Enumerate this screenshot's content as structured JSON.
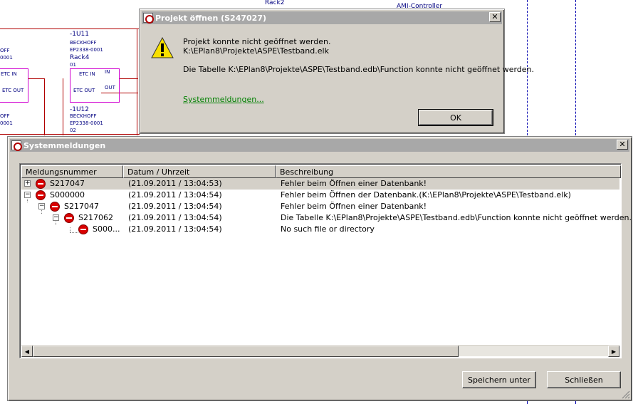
{
  "schematic": {
    "labels": {
      "rack2": "Rack2",
      "ami": "AMI-Controller",
      "u11_tag": "-1U11",
      "u11_maker": "BECKHOFF",
      "u11_part": "EP2338-0001",
      "u11_rack": "Rack4",
      "u11_pos": "01",
      "u12_tag": "-1U12",
      "u12_maker": "BECKHOFF",
      "u12_part": "EP2338-0001",
      "u12_pos": "02",
      "etc_in": "ETC IN",
      "in": "IN",
      "etc_out": "ETC OUT",
      "out": "OUT",
      "left_off": "OFF",
      "left_0001": "0001",
      "left_etc_in": "ETC IN",
      "left_etc_out": "ETC OUT",
      "left_e": "E"
    }
  },
  "dialog_open": {
    "title": "Projekt öffnen (S247027)",
    "line1": "Projekt konnte nicht geöffnet werden.",
    "line2": "K:\\EPlan8\\Projekte\\ASPE\\Testband.elk",
    "line3": "Die Tabelle K:\\EPlan8\\Projekte\\ASPE\\Testband.edb\\Function konnte nicht geöffnet werden.",
    "link": "Systemmeldungen...",
    "ok": "OK",
    "close": "✕"
  },
  "dialog_sys": {
    "title": "Systemmeldungen",
    "close": "✕",
    "columns": [
      "Meldungsnummer",
      "Datum / Uhrzeit",
      "Beschreibung"
    ],
    "rows": [
      {
        "number": "S217047",
        "datetime": "(21.09.2011 / 13:04:53)",
        "description": "Fehler beim Öffnen einer Datenbank!"
      },
      {
        "number": "S000000",
        "datetime": "(21.09.2011 / 13:04:54)",
        "description": "Fehler beim Öffnen der Datenbank.(K:\\EPlan8\\Projekte\\ASPE\\Testband.elk)"
      },
      {
        "number": "S217047",
        "datetime": "(21.09.2011 / 13:04:54)",
        "description": "Fehler beim Öffnen einer Datenbank!"
      },
      {
        "number": "S217062",
        "datetime": "(21.09.2011 / 13:04:54)",
        "description": "Die Tabelle K:\\EPlan8\\Projekte\\ASPE\\Testband.edb\\Function konnte nicht geöffnet werden."
      },
      {
        "number": "S000...",
        "datetime": "(21.09.2011 / 13:04:54)",
        "description": "No such file or directory"
      }
    ],
    "expanders": [
      "+",
      "−",
      "−",
      "−"
    ],
    "scroll_left": "◀",
    "scroll_right": "▶",
    "save_as": "Speichern unter",
    "close_button": "Schließen"
  },
  "colors": {
    "error_icon": "#d80000",
    "warning_icon": "#f8e000",
    "link": "#008000",
    "schematic_text": "#000080",
    "schematic_box": "#d000d0"
  }
}
